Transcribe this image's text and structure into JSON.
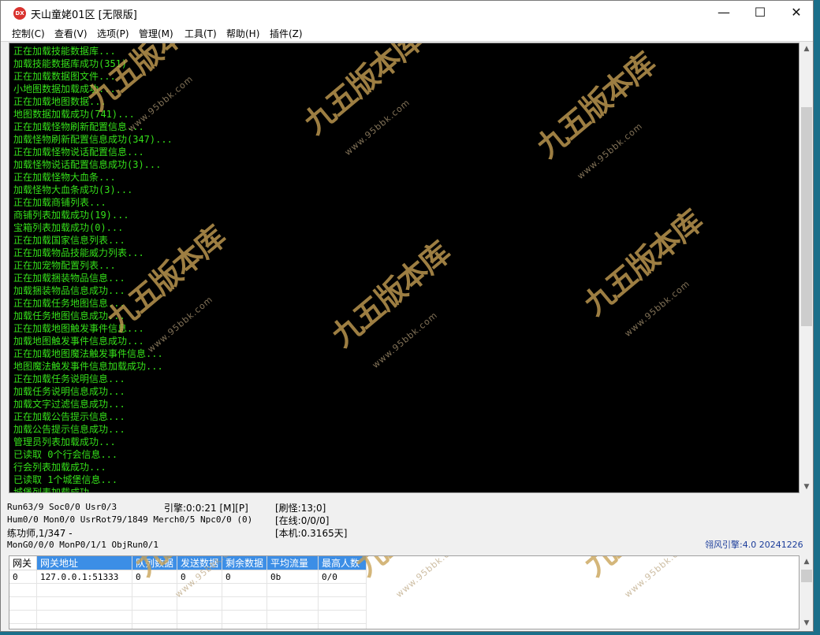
{
  "window": {
    "title": "天山童姥01区 [无限版]",
    "icon_text": "DX",
    "min_glyph": "—",
    "max_glyph": "☐",
    "close_glyph": "✕"
  },
  "menu": [
    "控制(C)",
    "查看(V)",
    "选项(P)",
    "管理(M)",
    "工具(T)",
    "帮助(H)",
    "插件(Z)"
  ],
  "console": {
    "lines": [
      "正在加载技能数据库...",
      "加载技能数据库成功(351)",
      "正在加载数据图文件...",
      "小地图数据加载成功...",
      "正在加载地图数据...",
      "地图数据加载成功(741)...",
      "正在加载怪物刷新配置信息...",
      "加载怪物刷新配置信息成功(347)...",
      "正在加载怪物说话配置信息...",
      "加载怪物说话配置信息成功(3)...",
      "正在加载怪物大血条...",
      "加载怪物大血条成功(3)...",
      "正在加载商铺列表...",
      "商铺列表加载成功(19)...",
      "宝箱列表加载成功(0)...",
      "正在加载国家信息列表...",
      "正在加载物品技能威力列表...",
      "正在加宠物配置列表...",
      "正在加载捆装物品信息...",
      "加载捆装物品信息成功...",
      "正在加载任务地图信息...",
      "加载任务地图信息成功...",
      "正在加载地图触发事件信息...",
      "加载地图触发事件信息成功...",
      "正在加载地图魔法触发事件信息...",
      "地图魔法触发事件信息加载成功...",
      "正在加载任务说明信息...",
      "加载任务说明信息成功...",
      "加载文字过滤信息成功...",
      "正在加载公告提示信息...",
      "加载公告提示信息成功...",
      "管理员列表加载成功...",
      "已读取 0个行会信息...",
      "行会列表加载成功...",
      "已读取 1个城堡信息...",
      "城堡列表加载成功..."
    ],
    "text_color": "#35e01a"
  },
  "watermark": {
    "main": "九五版本库",
    "sub": "www.95bbk.com"
  },
  "status": {
    "line1": "Run63/9 Soc0/0 Usr0/3",
    "line2": "Hum0/0 Mon0/0 UsrRot79/1849 Merch0/5 Npc0/0 (0)",
    "line3": "练功师,1/347 -",
    "line4": "MonG0/0/0 MonP0/1/1 ObjRun0/1",
    "engine_time": "引擎:0:0:21 [M][P]",
    "refresh": "[刷怪:13;0]",
    "online": "[在线:0/0/0]",
    "local": "[本机:0.3165天]",
    "engine_version": "翎风引擎:4.0 20241226"
  },
  "gateway_table": {
    "headers": [
      "网关",
      "网关地址",
      "队列数据",
      "发送数据",
      "剩余数据",
      "平均流量",
      "最高人数"
    ],
    "rows": [
      [
        "0",
        "127.0.0.1:51333",
        "0",
        "0",
        "0",
        "0b",
        "0/0"
      ],
      [
        "",
        "",
        "",
        "",
        "",
        "",
        ""
      ],
      [
        "",
        "",
        "",
        "",
        "",
        "",
        ""
      ],
      [
        "",
        "",
        "",
        "",
        "",
        "",
        ""
      ],
      [
        "",
        "",
        "",
        "",
        "",
        "",
        ""
      ]
    ]
  },
  "scroll": {
    "up_glyph": "▲",
    "down_glyph": "▼"
  }
}
